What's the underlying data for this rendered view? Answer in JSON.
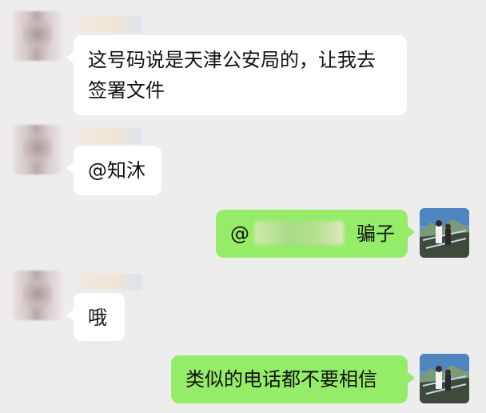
{
  "messages": [
    {
      "side": "left",
      "lines": [
        "这号码说是天津公安局的，让我去",
        "签署文件"
      ]
    },
    {
      "side": "left",
      "text": "@知沐"
    },
    {
      "side": "right",
      "prefix": "@",
      "suffix": "骗子"
    },
    {
      "side": "left",
      "text": "哦"
    },
    {
      "side": "right",
      "text": "类似的电话都不要相信"
    }
  ],
  "colors": {
    "background": "#ededed",
    "incoming_bubble": "#ffffff",
    "outgoing_bubble": "#95ec69",
    "text": "#111111"
  }
}
